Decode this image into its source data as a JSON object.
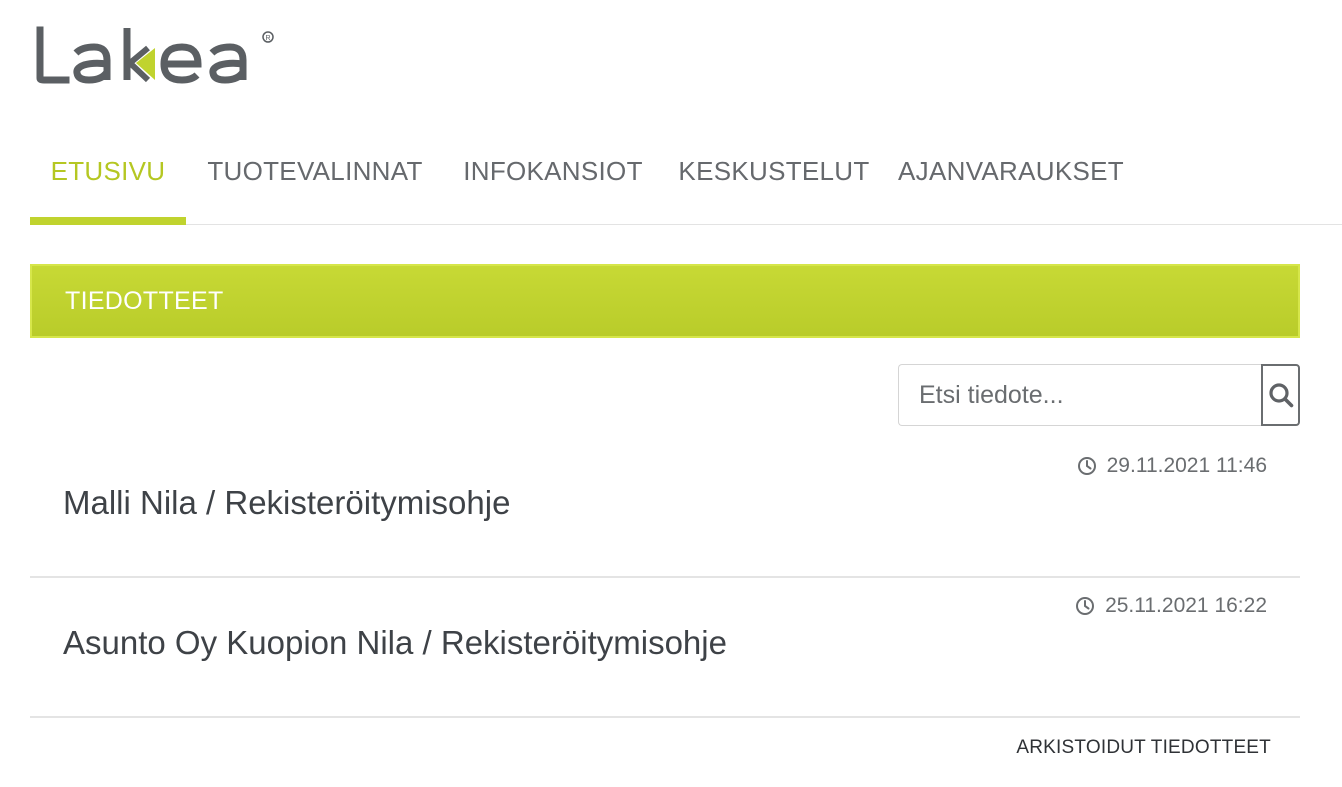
{
  "brand": {
    "logo_text": "Lakea",
    "accent_color": "#c0d32e"
  },
  "nav": {
    "items": [
      {
        "label": "ETUSIVU",
        "active": true
      },
      {
        "label": "TUOTEVALINNAT",
        "active": false
      },
      {
        "label": "INFOKANSIOT",
        "active": false
      },
      {
        "label": "KESKUSTELUT",
        "active": false
      },
      {
        "label": "AJANVARAUKSET",
        "active": false
      }
    ]
  },
  "section": {
    "title": "TIEDOTTEET"
  },
  "search": {
    "placeholder": "Etsi tiedote...",
    "value": "",
    "icon": "search-icon"
  },
  "bulletins": [
    {
      "date": "29.11.2021 11:46",
      "title": "Malli Nila / Rekisteröitymisohje",
      "icon": "clock-icon"
    },
    {
      "date": "25.11.2021 16:22",
      "title": "Asunto Oy Kuopion Nila / Rekisteröitymisohje",
      "icon": "clock-icon"
    }
  ],
  "archive": {
    "label": "ARKISTOIDUT TIEDOTTEET"
  }
}
